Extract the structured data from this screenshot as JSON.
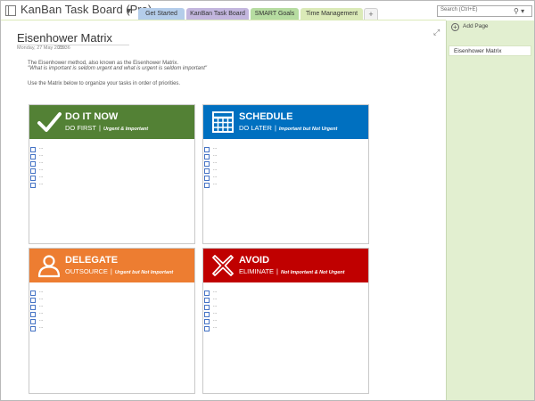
{
  "app": {
    "notebook_title": "KanBan Task Board (Pro)"
  },
  "tabs": [
    {
      "label": "Get Started"
    },
    {
      "label": "KanBan Task Board"
    },
    {
      "label": "SMART Goals"
    },
    {
      "label": "Time Management"
    },
    {
      "label": "+"
    }
  ],
  "search": {
    "placeholder": "Search (Ctrl+E)"
  },
  "page": {
    "title": "Eisenhower Matrix",
    "date": "Monday, 27 May 2019",
    "time": "23:36",
    "intro_line1": "The Eisenhower method, also known as the Eisenhower Matrix.",
    "intro_line2": "\"What is important is seldom urgent and what is urgent is seldom important\"",
    "intro_line3": "Use the Matrix below to organize your tasks in order of priorities."
  },
  "quadrants": {
    "do_now": {
      "title": "DO IT NOW",
      "subtitle": "DO FIRST",
      "separator": "|",
      "note": "Urgent & Important",
      "color": "#538135",
      "icon": "checkmark-icon",
      "items": [
        "...",
        "...",
        "...",
        "...",
        "...",
        "..."
      ]
    },
    "schedule": {
      "title": "SCHEDULE",
      "subtitle": "DO LATER",
      "separator": "|",
      "note": "Important but Not Urgent",
      "color": "#0070c0",
      "icon": "calendar-icon",
      "items": [
        "...",
        "...",
        "...",
        "...",
        "...",
        "..."
      ]
    },
    "delegate": {
      "title": "DELEGATE",
      "subtitle": "OUTSOURCE",
      "separator": "|",
      "note": "Urgent but Not Important",
      "color": "#ed7d31",
      "icon": "person-icon",
      "items": [
        "...",
        "...",
        "...",
        "...",
        "...",
        "..."
      ]
    },
    "avoid": {
      "title": "AVOID",
      "subtitle": "ELIMINATE",
      "separator": "|",
      "note": "Not Important & Not Urgent",
      "color": "#c00000",
      "icon": "x-mark-icon",
      "items": [
        "...",
        "...",
        "...",
        "...",
        "...",
        "..."
      ]
    }
  },
  "sidebar": {
    "add_page": "Add Page",
    "pages": [
      {
        "label": "Eisenhower Matrix"
      }
    ]
  }
}
